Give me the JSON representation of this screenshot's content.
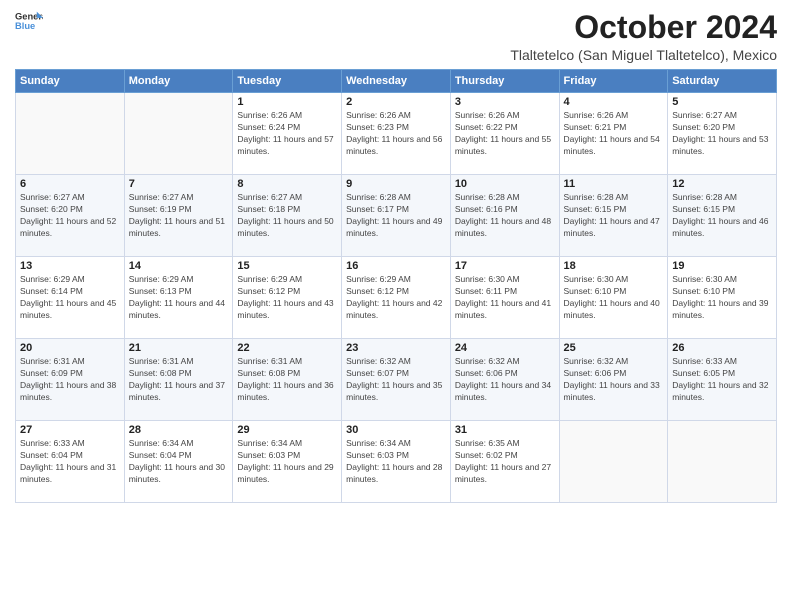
{
  "logo": {
    "line1": "General",
    "line2": "Blue"
  },
  "header": {
    "month_year": "October 2024",
    "location": "Tlaltetelco (San Miguel Tlaltetelco), Mexico"
  },
  "days_of_week": [
    "Sunday",
    "Monday",
    "Tuesday",
    "Wednesday",
    "Thursday",
    "Friday",
    "Saturday"
  ],
  "weeks": [
    [
      {
        "day": "",
        "sunrise": "",
        "sunset": "",
        "daylight": ""
      },
      {
        "day": "",
        "sunrise": "",
        "sunset": "",
        "daylight": ""
      },
      {
        "day": "1",
        "sunrise": "Sunrise: 6:26 AM",
        "sunset": "Sunset: 6:24 PM",
        "daylight": "Daylight: 11 hours and 57 minutes."
      },
      {
        "day": "2",
        "sunrise": "Sunrise: 6:26 AM",
        "sunset": "Sunset: 6:23 PM",
        "daylight": "Daylight: 11 hours and 56 minutes."
      },
      {
        "day": "3",
        "sunrise": "Sunrise: 6:26 AM",
        "sunset": "Sunset: 6:22 PM",
        "daylight": "Daylight: 11 hours and 55 minutes."
      },
      {
        "day": "4",
        "sunrise": "Sunrise: 6:26 AM",
        "sunset": "Sunset: 6:21 PM",
        "daylight": "Daylight: 11 hours and 54 minutes."
      },
      {
        "day": "5",
        "sunrise": "Sunrise: 6:27 AM",
        "sunset": "Sunset: 6:20 PM",
        "daylight": "Daylight: 11 hours and 53 minutes."
      }
    ],
    [
      {
        "day": "6",
        "sunrise": "Sunrise: 6:27 AM",
        "sunset": "Sunset: 6:20 PM",
        "daylight": "Daylight: 11 hours and 52 minutes."
      },
      {
        "day": "7",
        "sunrise": "Sunrise: 6:27 AM",
        "sunset": "Sunset: 6:19 PM",
        "daylight": "Daylight: 11 hours and 51 minutes."
      },
      {
        "day": "8",
        "sunrise": "Sunrise: 6:27 AM",
        "sunset": "Sunset: 6:18 PM",
        "daylight": "Daylight: 11 hours and 50 minutes."
      },
      {
        "day": "9",
        "sunrise": "Sunrise: 6:28 AM",
        "sunset": "Sunset: 6:17 PM",
        "daylight": "Daylight: 11 hours and 49 minutes."
      },
      {
        "day": "10",
        "sunrise": "Sunrise: 6:28 AM",
        "sunset": "Sunset: 6:16 PM",
        "daylight": "Daylight: 11 hours and 48 minutes."
      },
      {
        "day": "11",
        "sunrise": "Sunrise: 6:28 AM",
        "sunset": "Sunset: 6:15 PM",
        "daylight": "Daylight: 11 hours and 47 minutes."
      },
      {
        "day": "12",
        "sunrise": "Sunrise: 6:28 AM",
        "sunset": "Sunset: 6:15 PM",
        "daylight": "Daylight: 11 hours and 46 minutes."
      }
    ],
    [
      {
        "day": "13",
        "sunrise": "Sunrise: 6:29 AM",
        "sunset": "Sunset: 6:14 PM",
        "daylight": "Daylight: 11 hours and 45 minutes."
      },
      {
        "day": "14",
        "sunrise": "Sunrise: 6:29 AM",
        "sunset": "Sunset: 6:13 PM",
        "daylight": "Daylight: 11 hours and 44 minutes."
      },
      {
        "day": "15",
        "sunrise": "Sunrise: 6:29 AM",
        "sunset": "Sunset: 6:12 PM",
        "daylight": "Daylight: 11 hours and 43 minutes."
      },
      {
        "day": "16",
        "sunrise": "Sunrise: 6:29 AM",
        "sunset": "Sunset: 6:12 PM",
        "daylight": "Daylight: 11 hours and 42 minutes."
      },
      {
        "day": "17",
        "sunrise": "Sunrise: 6:30 AM",
        "sunset": "Sunset: 6:11 PM",
        "daylight": "Daylight: 11 hours and 41 minutes."
      },
      {
        "day": "18",
        "sunrise": "Sunrise: 6:30 AM",
        "sunset": "Sunset: 6:10 PM",
        "daylight": "Daylight: 11 hours and 40 minutes."
      },
      {
        "day": "19",
        "sunrise": "Sunrise: 6:30 AM",
        "sunset": "Sunset: 6:10 PM",
        "daylight": "Daylight: 11 hours and 39 minutes."
      }
    ],
    [
      {
        "day": "20",
        "sunrise": "Sunrise: 6:31 AM",
        "sunset": "Sunset: 6:09 PM",
        "daylight": "Daylight: 11 hours and 38 minutes."
      },
      {
        "day": "21",
        "sunrise": "Sunrise: 6:31 AM",
        "sunset": "Sunset: 6:08 PM",
        "daylight": "Daylight: 11 hours and 37 minutes."
      },
      {
        "day": "22",
        "sunrise": "Sunrise: 6:31 AM",
        "sunset": "Sunset: 6:08 PM",
        "daylight": "Daylight: 11 hours and 36 minutes."
      },
      {
        "day": "23",
        "sunrise": "Sunrise: 6:32 AM",
        "sunset": "Sunset: 6:07 PM",
        "daylight": "Daylight: 11 hours and 35 minutes."
      },
      {
        "day": "24",
        "sunrise": "Sunrise: 6:32 AM",
        "sunset": "Sunset: 6:06 PM",
        "daylight": "Daylight: 11 hours and 34 minutes."
      },
      {
        "day": "25",
        "sunrise": "Sunrise: 6:32 AM",
        "sunset": "Sunset: 6:06 PM",
        "daylight": "Daylight: 11 hours and 33 minutes."
      },
      {
        "day": "26",
        "sunrise": "Sunrise: 6:33 AM",
        "sunset": "Sunset: 6:05 PM",
        "daylight": "Daylight: 11 hours and 32 minutes."
      }
    ],
    [
      {
        "day": "27",
        "sunrise": "Sunrise: 6:33 AM",
        "sunset": "Sunset: 6:04 PM",
        "daylight": "Daylight: 11 hours and 31 minutes."
      },
      {
        "day": "28",
        "sunrise": "Sunrise: 6:34 AM",
        "sunset": "Sunset: 6:04 PM",
        "daylight": "Daylight: 11 hours and 30 minutes."
      },
      {
        "day": "29",
        "sunrise": "Sunrise: 6:34 AM",
        "sunset": "Sunset: 6:03 PM",
        "daylight": "Daylight: 11 hours and 29 minutes."
      },
      {
        "day": "30",
        "sunrise": "Sunrise: 6:34 AM",
        "sunset": "Sunset: 6:03 PM",
        "daylight": "Daylight: 11 hours and 28 minutes."
      },
      {
        "day": "31",
        "sunrise": "Sunrise: 6:35 AM",
        "sunset": "Sunset: 6:02 PM",
        "daylight": "Daylight: 11 hours and 27 minutes."
      },
      {
        "day": "",
        "sunrise": "",
        "sunset": "",
        "daylight": ""
      },
      {
        "day": "",
        "sunrise": "",
        "sunset": "",
        "daylight": ""
      }
    ]
  ]
}
